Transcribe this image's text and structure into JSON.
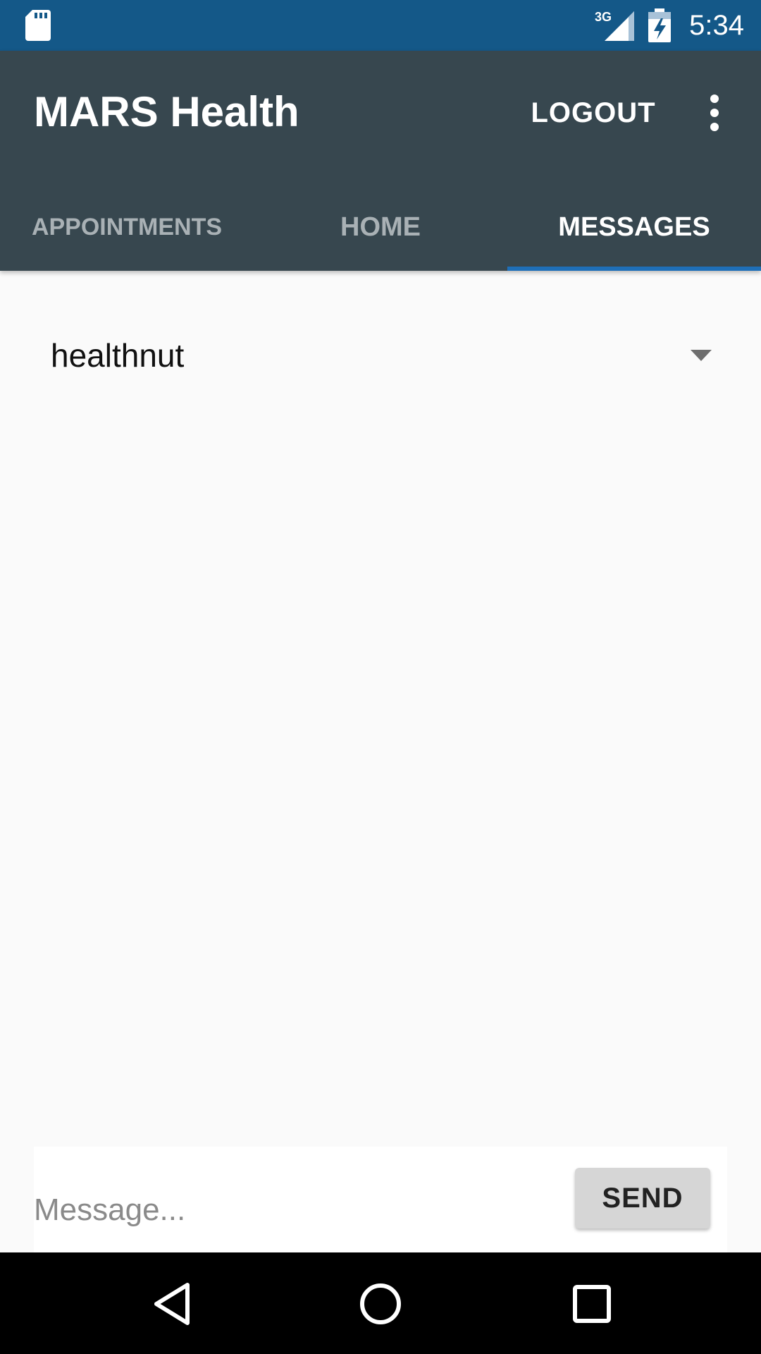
{
  "status_bar": {
    "network_type": "3G",
    "time": "5:34",
    "icons": [
      "sd-card-icon",
      "cellular-signal-icon",
      "battery-charging-icon"
    ]
  },
  "app_bar": {
    "title": "MARS Health",
    "logout_label": "LOGOUT",
    "overflow_icon": "more-vert-icon"
  },
  "tabs": [
    {
      "label": "APPOINTMENTS",
      "active": false
    },
    {
      "label": "HOME",
      "active": false
    },
    {
      "label": "MESSAGES",
      "active": true
    }
  ],
  "messages": {
    "recipient_selected": "healthnut",
    "composer": {
      "placeholder": "Message...",
      "value": "",
      "send_label": "SEND"
    }
  },
  "colors": {
    "status_bar": "#145888",
    "app_bar": "#37474f",
    "tab_indicator": "#1e6fb8",
    "background": "#fafafa"
  },
  "nav_bar": {
    "icons": [
      "back-icon",
      "home-circle-icon",
      "recents-icon"
    ]
  }
}
